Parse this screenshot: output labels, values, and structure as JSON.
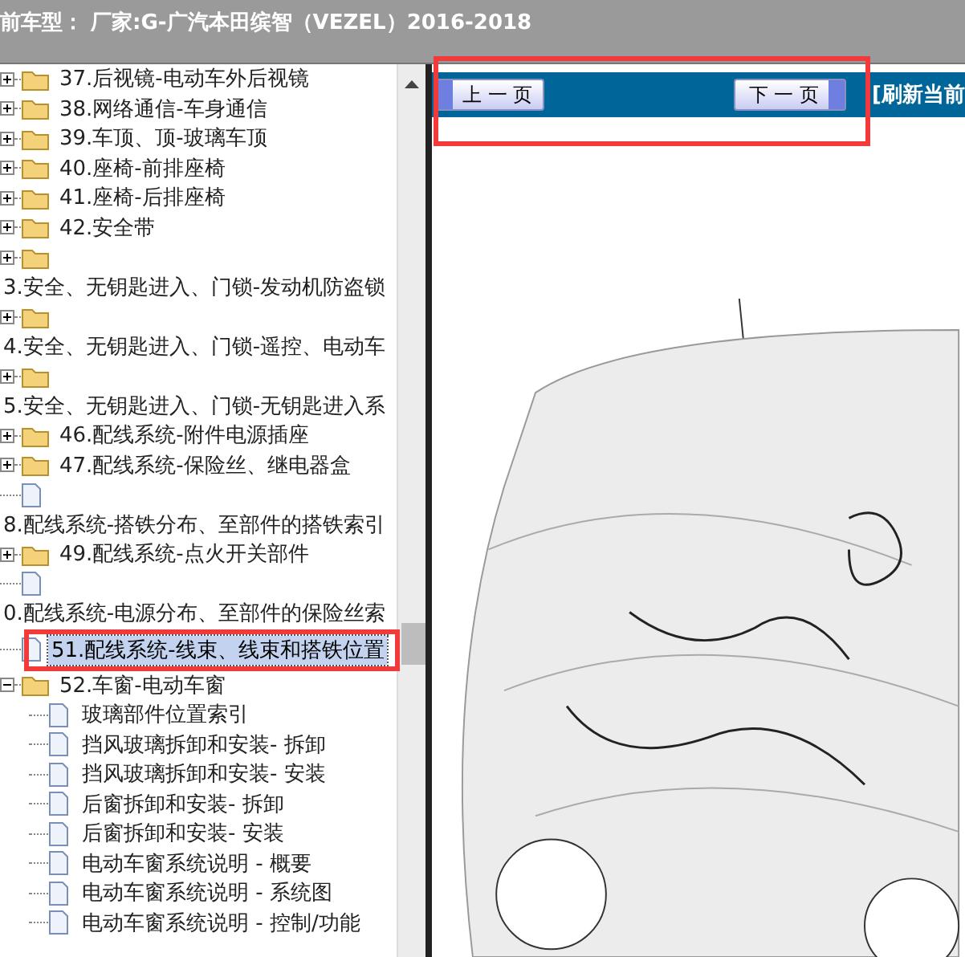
{
  "header": {
    "title": "前车型： 厂家:G-广汽本田缤智（VEZEL）2016-2018"
  },
  "tree": {
    "items": [
      {
        "kind": "folder",
        "label": "37.后视镜-电动车外后视镜",
        "expanded": false,
        "selected": false
      },
      {
        "kind": "folder",
        "label": "38.网络通信-车身通信",
        "expanded": false,
        "selected": false
      },
      {
        "kind": "folder",
        "label": "39.车顶、顶-玻璃车顶",
        "expanded": false,
        "selected": false
      },
      {
        "kind": "folder",
        "label": "40.座椅-前排座椅",
        "expanded": false,
        "selected": false
      },
      {
        "kind": "folder",
        "label": "41.座椅-后排座椅",
        "expanded": false,
        "selected": false
      },
      {
        "kind": "folder",
        "label": "42.安全带",
        "expanded": false,
        "selected": false
      },
      {
        "kind": "folder",
        "expanded": false,
        "selected": false
      },
      {
        "kind": "text",
        "label": "3.安全、无钥匙进入、门锁-发动机防盗锁",
        "selected": false
      },
      {
        "kind": "folder",
        "expanded": false,
        "selected": false
      },
      {
        "kind": "text",
        "label": "4.安全、无钥匙进入、门锁-遥控、电动车",
        "selected": false
      },
      {
        "kind": "folder",
        "expanded": false,
        "selected": false
      },
      {
        "kind": "text",
        "label": "5.安全、无钥匙进入、门锁-无钥匙进入系",
        "selected": false
      },
      {
        "kind": "folder",
        "label": "46.配线系统-附件电源插座",
        "expanded": false,
        "selected": false
      },
      {
        "kind": "folder",
        "label": "47.配线系统-保险丝、继电器盒",
        "expanded": false,
        "selected": false
      },
      {
        "kind": "doc",
        "selected": false
      },
      {
        "kind": "text",
        "label": "8.配线系统-搭铁分布、至部件的搭铁索引",
        "selected": false
      },
      {
        "kind": "folder",
        "label": "49.配线系统-点火开关部件",
        "expanded": false,
        "selected": false
      },
      {
        "kind": "doc",
        "selected": false
      },
      {
        "kind": "text",
        "label": "0.配线系统-电源分布、至部件的保险丝索",
        "selected": false
      },
      {
        "kind": "doc",
        "label": "51.配线系统-线束、线束和搭铁位置",
        "selected": true
      },
      {
        "kind": "folder",
        "label": "52.车窗-电动车窗",
        "expanded": true,
        "selected": false,
        "children": [
          {
            "kind": "doc",
            "label": "玻璃部件位置索引",
            "selected": false
          },
          {
            "kind": "doc",
            "label": "挡风玻璃拆卸和安装- 拆卸",
            "selected": false
          },
          {
            "kind": "doc",
            "label": "挡风玻璃拆卸和安装- 安装",
            "selected": false
          },
          {
            "kind": "doc",
            "label": "后窗拆卸和安装- 拆卸",
            "selected": false
          },
          {
            "kind": "doc",
            "label": "后窗拆卸和安装- 安装",
            "selected": false
          },
          {
            "kind": "doc",
            "label": "电动车窗系统说明 - 概要",
            "selected": false
          },
          {
            "kind": "doc",
            "label": "电动车窗系统说明 - 系统图",
            "selected": false
          },
          {
            "kind": "doc",
            "label": "电动车窗系统说明 - 控制/功能",
            "selected": false
          }
        ]
      }
    ]
  },
  "viewer": {
    "prev_button": "上 一 页",
    "next_button": "下 一 页",
    "refresh_link": "[刷新当前"
  }
}
